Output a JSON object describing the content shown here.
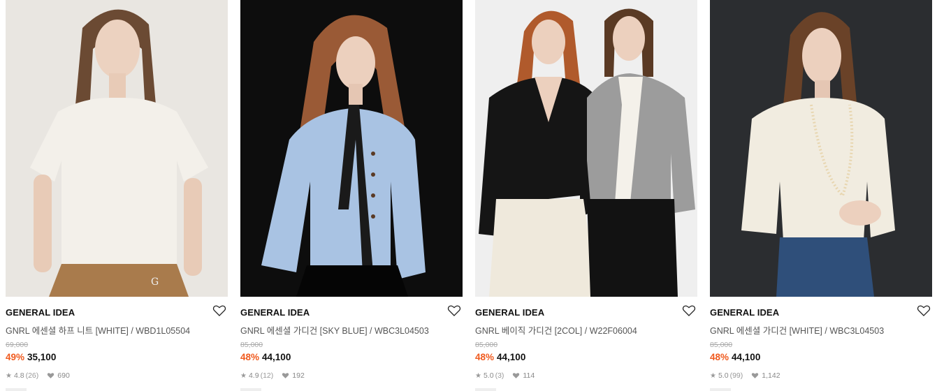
{
  "products": [
    {
      "brand": "GENERAL IDEA",
      "name": "GNRL 에센셜 하프 니트 [WHITE] / WBD1L05504",
      "original_price": "69,000",
      "discount": "49%",
      "price": "35,100",
      "rating": "4.8",
      "reviews": "(26)",
      "likes": "690",
      "image": "model-white-half-knit-photo"
    },
    {
      "brand": "GENERAL IDEA",
      "name": "GNRL 에센셜 가디건 [SKY BLUE] / WBC3L04503",
      "original_price": "85,000",
      "discount": "48%",
      "price": "44,100",
      "rating": "4.9",
      "reviews": "(12)",
      "likes": "192",
      "image": "model-sky-blue-cardigan-photo"
    },
    {
      "brand": "GENERAL IDEA",
      "name": "GNRL 베이직 가디건 [2COL] / W22F06004",
      "original_price": "85,000",
      "discount": "48%",
      "price": "44,100",
      "rating": "5.0",
      "reviews": "(3)",
      "likes": "114",
      "image": "two-models-black-grey-cardigan-photo"
    },
    {
      "brand": "GENERAL IDEA",
      "name": "GNRL 에센셜 가디건 [WHITE] / WBC3L04503",
      "original_price": "85,000",
      "discount": "48%",
      "price": "44,100",
      "rating": "5.0",
      "reviews": "(99)",
      "likes": "1,142",
      "image": "model-white-cardigan-photo"
    }
  ],
  "colors": {
    "discount": "#f05a1e",
    "brand_text": "#111111",
    "meta_text": "#888888"
  }
}
